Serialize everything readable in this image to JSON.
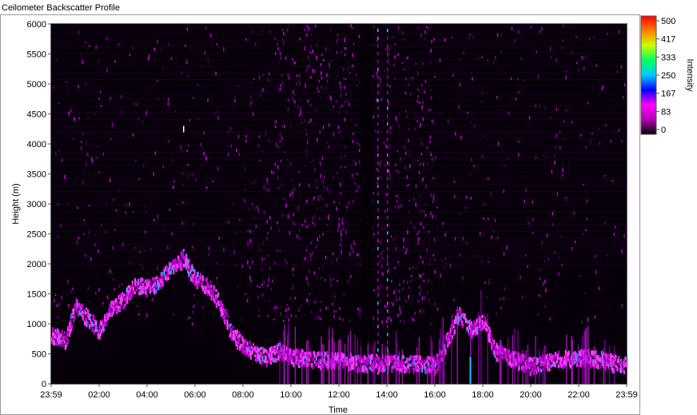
{
  "chart_data": {
    "type": "heatmap",
    "title": "Ceilometer Backscatter Profile",
    "xlabel": "Time",
    "ylabel": "Height (m)",
    "x_tick_labels": [
      "23:59",
      "02:00",
      "04:00",
      "06:00",
      "08:00",
      "10:00",
      "12:00",
      "14:00",
      "16:00",
      "18:00",
      "20:00",
      "22:00",
      "23:59"
    ],
    "y_tick_labels": [
      "0",
      "500",
      "1000",
      "1500",
      "2000",
      "2500",
      "3000",
      "3500",
      "4000",
      "4500",
      "5000",
      "5500",
      "6000"
    ],
    "xlim_hours": [
      0,
      24
    ],
    "ylim": [
      0,
      6000
    ],
    "colorbar": {
      "label": "Intensity",
      "range": [
        0,
        500
      ],
      "tick_labels": [
        "500",
        "417",
        "333",
        "250",
        "167",
        "83",
        "0"
      ],
      "colors": [
        "#000000",
        "#b400b4",
        "#ff00ff",
        "#0000ff",
        "#00c8ff",
        "#00ff64",
        "#c8ff00",
        "#ff8000",
        "#ff0000"
      ]
    },
    "boundary_layer_top": [
      {
        "t": 0.0,
        "h": 950
      },
      {
        "t": 0.6,
        "h": 880
      },
      {
        "t": 1.0,
        "h": 1450
      },
      {
        "t": 1.5,
        "h": 1250
      },
      {
        "t": 2.0,
        "h": 1050
      },
      {
        "t": 2.5,
        "h": 1400
      },
      {
        "t": 3.0,
        "h": 1550
      },
      {
        "t": 3.5,
        "h": 1800
      },
      {
        "t": 4.0,
        "h": 1750
      },
      {
        "t": 4.5,
        "h": 1850
      },
      {
        "t": 5.0,
        "h": 2100
      },
      {
        "t": 5.5,
        "h": 2250
      },
      {
        "t": 6.0,
        "h": 1900
      },
      {
        "t": 6.5,
        "h": 1800
      },
      {
        "t": 7.0,
        "h": 1500
      },
      {
        "t": 7.5,
        "h": 1000
      },
      {
        "t": 8.0,
        "h": 800
      },
      {
        "t": 8.5,
        "h": 650
      },
      {
        "t": 9.0,
        "h": 600
      },
      {
        "t": 9.5,
        "h": 700
      },
      {
        "t": 10.0,
        "h": 600
      },
      {
        "t": 11.0,
        "h": 550
      },
      {
        "t": 12.0,
        "h": 550
      },
      {
        "t": 13.0,
        "h": 500
      },
      {
        "t": 14.0,
        "h": 500
      },
      {
        "t": 15.0,
        "h": 500
      },
      {
        "t": 16.0,
        "h": 450
      },
      {
        "t": 17.0,
        "h": 1300
      },
      {
        "t": 17.5,
        "h": 1050
      },
      {
        "t": 18.0,
        "h": 1200
      },
      {
        "t": 18.5,
        "h": 700
      },
      {
        "t": 19.0,
        "h": 600
      },
      {
        "t": 20.0,
        "h": 450
      },
      {
        "t": 21.0,
        "h": 550
      },
      {
        "t": 22.0,
        "h": 600
      },
      {
        "t": 23.0,
        "h": 550
      },
      {
        "t": 24.0,
        "h": 450
      }
    ]
  }
}
